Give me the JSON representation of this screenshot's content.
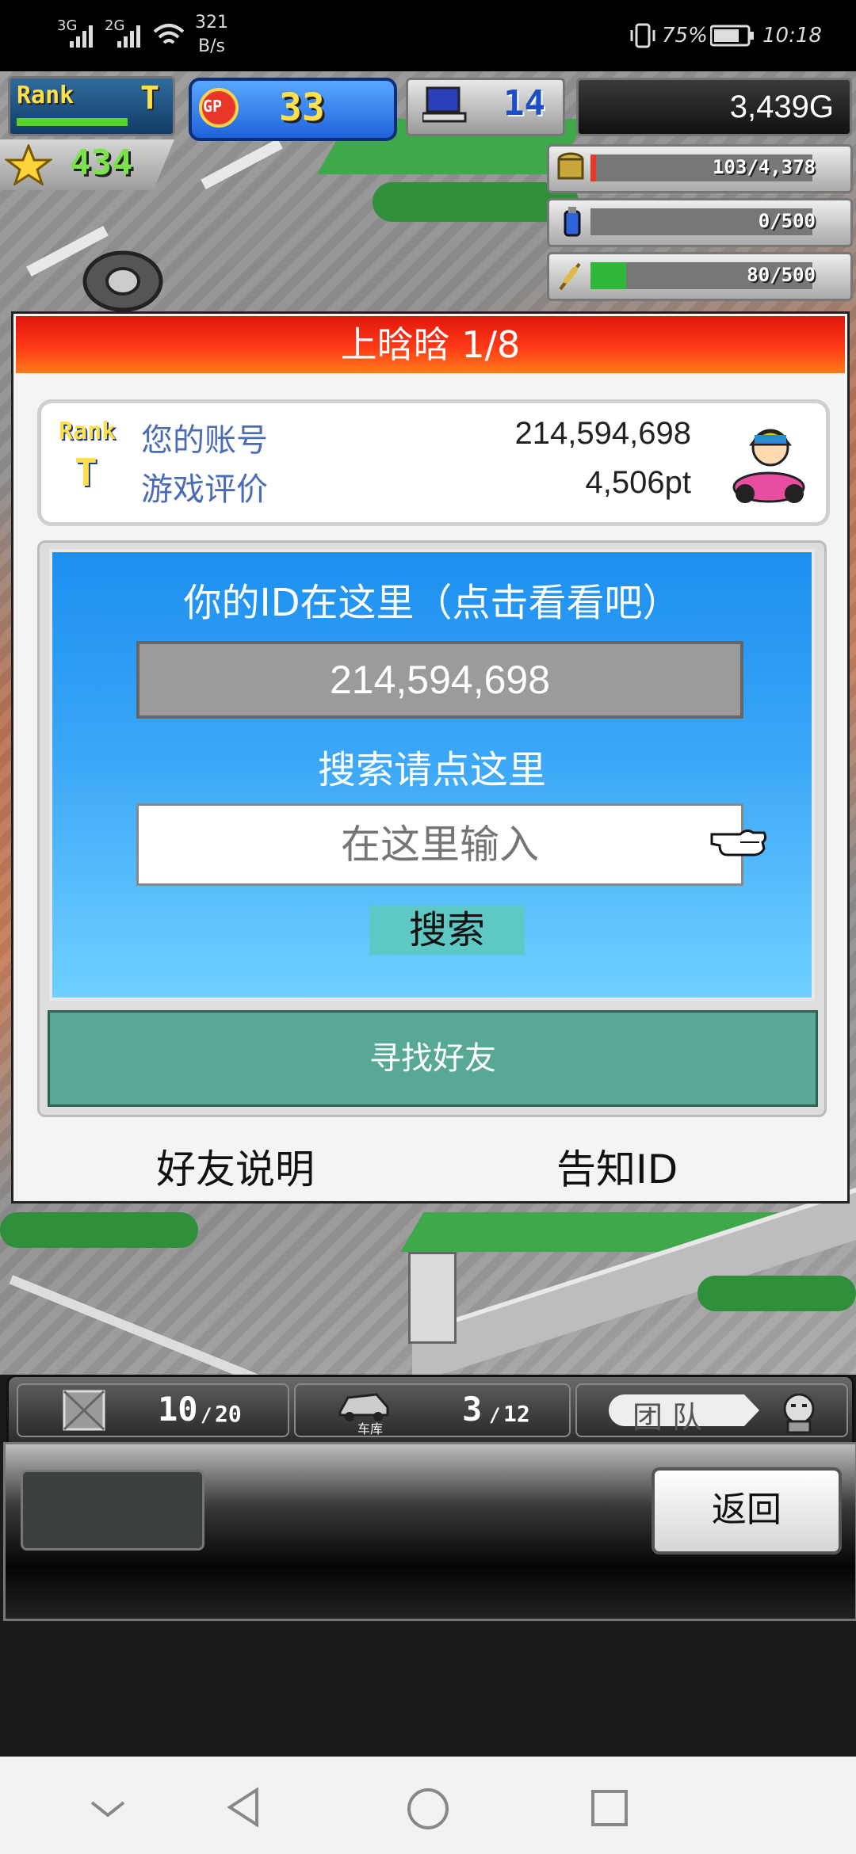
{
  "status_bar": {
    "signal1": "3G",
    "signal2": "2G",
    "speed_value": "321",
    "speed_unit": "B/s",
    "battery_percent": "75%",
    "time": "10:18"
  },
  "hud": {
    "rank_label": "Rank",
    "rank_value": "T",
    "gp_label": "GP",
    "gp_value": "33",
    "computer_value": "14",
    "gold": "3,439G",
    "stars": "434",
    "resource_money": "103/4,378",
    "resource_fuel": "0/500",
    "resource_grain": "80/500"
  },
  "dialog": {
    "title": "上晗晗 1/8",
    "rank_label": "Rank",
    "rank_value": "T",
    "account_label": "您的账号",
    "account_value": "214,594,698",
    "rating_label": "游戏评价",
    "rating_value": "4,506pt",
    "id_heading": "你的ID在这里（点击看看吧）",
    "id_value": "214,594,698",
    "search_heading": "搜索请点这里",
    "search_placeholder": "在这里输入",
    "search_button": "搜索",
    "find_friends": "寻找好友",
    "friend_help": "好友说明",
    "share_id": "告知ID"
  },
  "bottom": {
    "storage_count": "10",
    "storage_max": "20",
    "garage_label": "车库",
    "garage_count": "3",
    "garage_max": "12",
    "team_label": "团队",
    "back_button": "返回"
  },
  "colors": {
    "title_red": "#e0160d",
    "panel_blue": "#1c8ff0",
    "friend_teal": "#58a896",
    "search_teal": "#5ec8c4"
  }
}
